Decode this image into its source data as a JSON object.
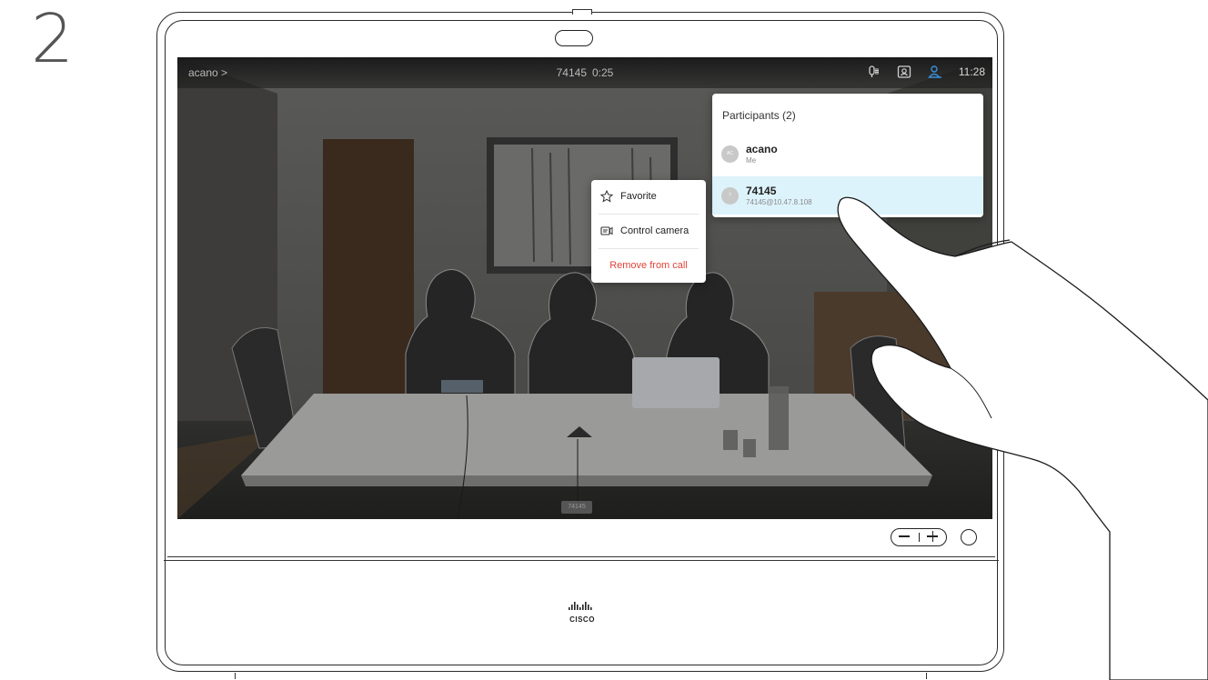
{
  "step_number": "2",
  "topbar": {
    "left_label": "acano >",
    "call_number": "74145",
    "call_duration": "0:25",
    "time": "11:28",
    "icons": [
      "mic-icon",
      "selfview-icon",
      "participants-icon"
    ]
  },
  "participants_panel": {
    "title": "Participants (2)",
    "items": [
      {
        "initials": "AC",
        "name": "acano",
        "detail": "Me",
        "selected": false
      },
      {
        "initials": "7",
        "name": "74145",
        "detail": "74145@10.47.8.108",
        "selected": true
      }
    ]
  },
  "context_menu": {
    "items": [
      {
        "label": "Favorite",
        "icon": "star-icon"
      },
      {
        "label": "Control camera",
        "icon": "camera-control-icon"
      },
      {
        "label": "Remove from call",
        "style": "danger"
      }
    ]
  },
  "video_name_tag": "74145",
  "brand": "CISCO",
  "colors": {
    "accent_selected": "#ddf3fb",
    "danger": "#e0433a",
    "participants_icon": "#3a8fd8"
  }
}
